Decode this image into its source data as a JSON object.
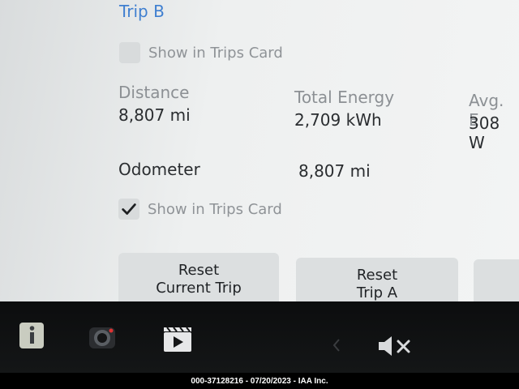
{
  "trip": {
    "title": "Trip B"
  },
  "checkbox_top": {
    "label": "Show in Trips Card"
  },
  "stats": {
    "distance_label": "Distance",
    "distance_value": "8,807 mi",
    "energy_label": "Total Energy",
    "energy_value": "2,709 kWh",
    "avg_label": "Avg. E",
    "avg_value": "308 W"
  },
  "odometer": {
    "label": "Odometer",
    "value": "8,807 mi"
  },
  "checkbox_bottom": {
    "label": "Show in Trips Card",
    "checked": true
  },
  "buttons": {
    "reset_current_line1": "Reset",
    "reset_current_line2": "Current Trip",
    "reset_a_line1": "Reset",
    "reset_a_line2": "Trip A"
  },
  "taskbar": {
    "icons": [
      "info-icon",
      "camera-icon",
      "video-icon",
      "chevron-left-icon",
      "volume-mute-icon"
    ]
  },
  "footer": {
    "text": "000-37128216 - 07/20/2023 - IAA Inc."
  }
}
